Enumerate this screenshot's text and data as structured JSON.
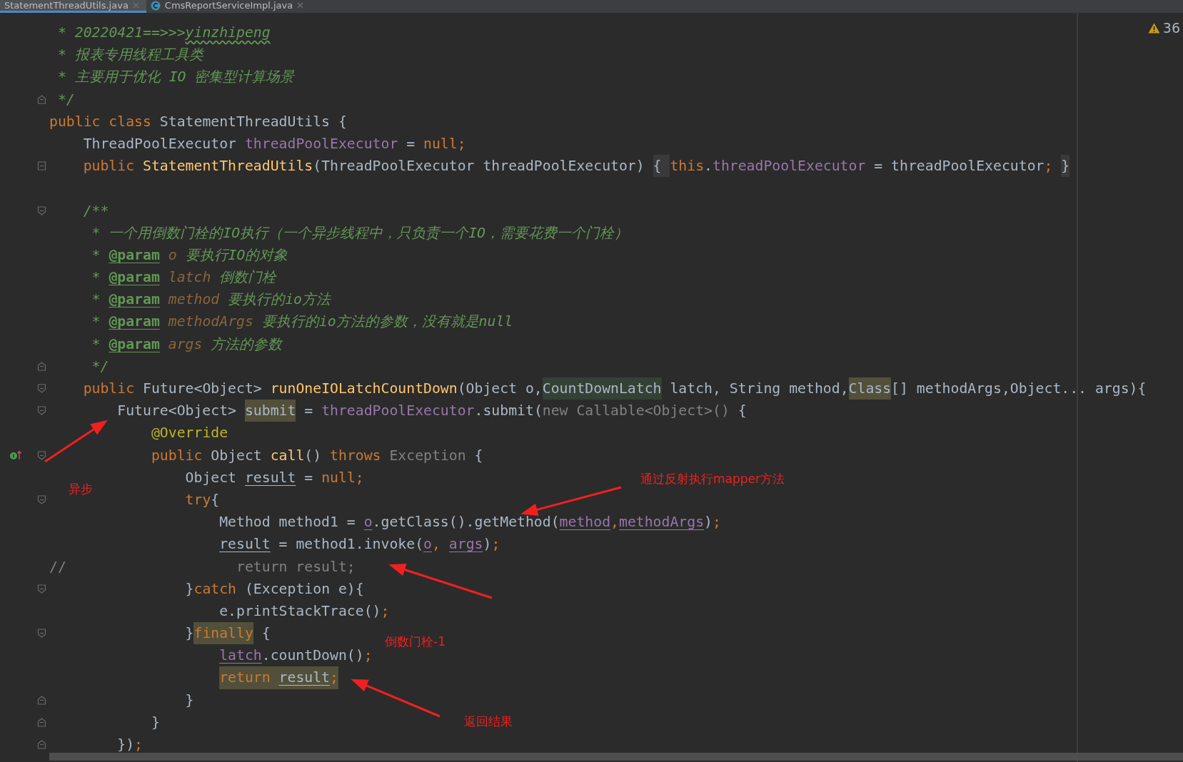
{
  "tabs": [
    {
      "label": "StatementThreadUtils.java",
      "selected": true,
      "icon": false
    },
    {
      "label": "CmsReportServiceImpl.java",
      "selected": false,
      "icon": true
    }
  ],
  "inspections": {
    "warnings": "36"
  },
  "lines": [
    {
      "kind": "plain",
      "tokens": [
        {
          "text": " * 20220421==>>>",
          "kind": "comment"
        },
        {
          "text": "yinzhipeng",
          "kind": "comment",
          "misspelled": true
        }
      ]
    },
    {
      "kind": "plain",
      "tokens": [
        {
          "text": " * 报表专用线程工具类",
          "kind": "comment"
        }
      ]
    },
    {
      "kind": "plain",
      "tokens": [
        {
          "text": " * 主要用于优化 IO 密集型计算场景",
          "kind": "comment"
        }
      ]
    },
    {
      "kind": "fold_end",
      "tokens": [
        {
          "text": " */",
          "kind": "comment"
        }
      ]
    },
    {
      "kind": "plain",
      "tokens": [
        {
          "text": "public class",
          "kind": "keyword"
        },
        {
          "text": " StatementThreadUtils {",
          "kind": "plain"
        }
      ]
    },
    {
      "kind": "plain",
      "tokens": [
        {
          "text": "    ThreadPoolExecutor ",
          "kind": "plain"
        },
        {
          "text": "threadPoolExecutor",
          "kind": "field"
        },
        {
          "text": " = ",
          "kind": "plain"
        },
        {
          "text": "null;",
          "kind": "keyword"
        }
      ]
    },
    {
      "kind": "fold_block",
      "tokens": [
        {
          "text": "    public",
          "kind": "keyword"
        },
        {
          "text": " StatementThreadUtils",
          "kind": "declaration"
        },
        {
          "text": "(ThreadPoolExecutor threadPoolExecutor) ",
          "kind": "plain"
        },
        {
          "text": "{ ",
          "kind": "folded_brace"
        },
        {
          "text": "this",
          "kind": "keyword"
        },
        {
          "text": ".",
          "kind": "plain"
        },
        {
          "text": "threadPoolExecutor",
          "kind": "field"
        },
        {
          "text": " = threadPoolExecutor",
          "kind": "plain"
        },
        {
          "text": ";",
          "kind": "keyword"
        },
        {
          "text": " }",
          "kind": "folded_brace"
        }
      ]
    },
    {
      "kind": "plain"
    },
    {
      "kind": "fold_start",
      "tokens": [
        {
          "text": "    /**",
          "kind": "comment"
        }
      ]
    },
    {
      "kind": "plain",
      "tokens": [
        {
          "text": "     * 一个用倒数门栓的IO执行（一个异步线程中，只负责一个IO，需要花费一个门栓）",
          "kind": "comment"
        }
      ]
    },
    {
      "kind": "plain",
      "tokens": [
        {
          "text": "     * ",
          "kind": "comment"
        },
        {
          "text": "@param",
          "kind": "doc_tag"
        },
        {
          "text": " o",
          "kind": "doc_param"
        },
        {
          "text": " 要执行IO的对象",
          "kind": "comment"
        }
      ]
    },
    {
      "kind": "plain",
      "tokens": [
        {
          "text": "     * ",
          "kind": "comment"
        },
        {
          "text": "@param",
          "kind": "doc_tag"
        },
        {
          "text": " latch",
          "kind": "doc_param"
        },
        {
          "text": " 倒数门栓",
          "kind": "comment"
        }
      ]
    },
    {
      "kind": "plain",
      "tokens": [
        {
          "text": "     * ",
          "kind": "comment"
        },
        {
          "text": "@param",
          "kind": "doc_tag"
        },
        {
          "text": " method",
          "kind": "doc_param"
        },
        {
          "text": " 要执行的io方法",
          "kind": "comment"
        }
      ]
    },
    {
      "kind": "plain",
      "tokens": [
        {
          "text": "     * ",
          "kind": "comment"
        },
        {
          "text": "@param",
          "kind": "doc_tag"
        },
        {
          "text": " methodArgs",
          "kind": "doc_param"
        },
        {
          "text": " 要执行的io方法的参数，没有就是null",
          "kind": "comment"
        }
      ]
    },
    {
      "kind": "plain",
      "tokens": [
        {
          "text": "     * ",
          "kind": "comment"
        },
        {
          "text": "@param",
          "kind": "doc_tag"
        },
        {
          "text": " args",
          "kind": "doc_param"
        },
        {
          "text": " 方法的参数",
          "kind": "comment"
        }
      ]
    },
    {
      "kind": "fold_end",
      "tokens": [
        {
          "text": "     */",
          "kind": "comment"
        }
      ]
    },
    {
      "kind": "fold_start",
      "tokens": [
        {
          "text": "    public",
          "kind": "keyword"
        },
        {
          "text": " Future<Object> ",
          "kind": "plain"
        },
        {
          "text": "runOneIOLatchCountDown",
          "kind": "declaration"
        },
        {
          "text": "(Object o,",
          "kind": "plain"
        },
        {
          "text": "CountDownLatch",
          "kind": "type_usage"
        },
        {
          "text": " latch,",
          "kind": "plain"
        },
        {
          "text": " String method,",
          "kind": "plain"
        },
        {
          "text": "Class",
          "kind": "plain",
          "highlighted": true
        },
        {
          "text": "[] methodArgs,",
          "kind": "plain"
        },
        {
          "text": "Object... args){",
          "kind": "plain"
        }
      ]
    },
    {
      "kind": "fold_start",
      "tokens": [
        {
          "text": "        Future<Object> ",
          "kind": "plain"
        },
        {
          "text": "submit",
          "kind": "plain",
          "highlighted": true
        },
        {
          "text": " = ",
          "kind": "plain"
        },
        {
          "text": "threadPoolExecutor",
          "kind": "field"
        },
        {
          "text": ".submit(",
          "kind": "plain"
        },
        {
          "text": "new Callable<Object>()",
          "kind": "dim"
        },
        {
          "text": " {",
          "kind": "plain"
        }
      ]
    },
    {
      "kind": "plain",
      "tokens": [
        {
          "text": "            @Override",
          "kind": "annotation"
        }
      ]
    },
    {
      "kind": "fold_start",
      "override": true,
      "tokens": [
        {
          "text": "            public",
          "kind": "keyword"
        },
        {
          "text": " Object ",
          "kind": "plain"
        },
        {
          "text": "call",
          "kind": "declaration"
        },
        {
          "text": "() ",
          "kind": "plain"
        },
        {
          "text": "throws",
          "kind": "keyword"
        },
        {
          "text": " Exception",
          "kind": "dim"
        },
        {
          "text": " {",
          "kind": "plain"
        }
      ]
    },
    {
      "kind": "plain",
      "tokens": [
        {
          "text": "                Object ",
          "kind": "plain"
        },
        {
          "text": "result",
          "kind": "plain",
          "underlined": true
        },
        {
          "text": " = ",
          "kind": "plain"
        },
        {
          "text": "null;",
          "kind": "keyword"
        }
      ]
    },
    {
      "kind": "fold_start",
      "tokens": [
        {
          "text": "                try",
          "kind": "keyword"
        },
        {
          "text": "{",
          "kind": "plain"
        }
      ]
    },
    {
      "kind": "plain",
      "tokens": [
        {
          "text": "                    Method method1 = ",
          "kind": "plain"
        },
        {
          "text": "o",
          "kind": "field",
          "underlined": true
        },
        {
          "text": ".getClass().getMethod(",
          "kind": "plain"
        },
        {
          "text": "method",
          "kind": "field",
          "underlined": true
        },
        {
          "text": ",",
          "kind": "keyword"
        },
        {
          "text": "methodArgs",
          "kind": "field",
          "underlined": true
        },
        {
          "text": ")",
          "kind": "plain"
        },
        {
          "text": ";",
          "kind": "keyword"
        }
      ]
    },
    {
      "kind": "plain",
      "tokens": [
        {
          "text": "                    result",
          "kind": "plain",
          "underlined": true
        },
        {
          "text": " = method1.invoke(",
          "kind": "plain"
        },
        {
          "text": "o",
          "kind": "field",
          "underlined": true
        },
        {
          "text": ",",
          "kind": "keyword"
        },
        {
          "text": " args",
          "kind": "field",
          "underlined": true
        },
        {
          "text": ")",
          "kind": "plain"
        },
        {
          "text": ";",
          "kind": "keyword"
        }
      ]
    },
    {
      "kind": "plain",
      "tokens": [
        {
          "text": "//                    return result;",
          "kind": "line_comment"
        }
      ]
    },
    {
      "kind": "fold_start",
      "tokens": [
        {
          "text": "                }",
          "kind": "plain"
        },
        {
          "text": "catch",
          "kind": "keyword"
        },
        {
          "text": " (Exception e){",
          "kind": "plain"
        }
      ]
    },
    {
      "kind": "plain",
      "tokens": [
        {
          "text": "                    e.printStackTrace()",
          "kind": "plain"
        },
        {
          "text": ";",
          "kind": "keyword"
        }
      ]
    },
    {
      "kind": "fold_start",
      "tokens": [
        {
          "text": "                }",
          "kind": "plain"
        },
        {
          "text": "finally",
          "kind": "keyword",
          "highlighted": true
        },
        {
          "text": " {",
          "kind": "plain"
        }
      ]
    },
    {
      "kind": "plain",
      "tokens": [
        {
          "text": "                    latch",
          "kind": "field",
          "underlined": true
        },
        {
          "text": ".countDown()",
          "kind": "plain"
        },
        {
          "text": ";",
          "kind": "keyword"
        }
      ]
    },
    {
      "kind": "plain",
      "tokens": [
        {
          "text": "                    return ",
          "kind": "keyword",
          "highlighted": true
        },
        {
          "text": "result",
          "kind": "plain",
          "underlined": true,
          "highlighted": true
        },
        {
          "text": ";",
          "kind": "keyword",
          "highlighted": true
        }
      ]
    },
    {
      "kind": "fold_end",
      "tokens": [
        {
          "text": "                }",
          "kind": "plain"
        }
      ]
    },
    {
      "kind": "fold_end",
      "tokens": [
        {
          "text": "            }",
          "kind": "plain"
        }
      ]
    },
    {
      "kind": "fold_end",
      "tokens": [
        {
          "text": "        })",
          "kind": "plain"
        },
        {
          "text": ";",
          "kind": "keyword"
        }
      ]
    }
  ],
  "annotations": [
    {
      "text": "异步"
    },
    {
      "text": "通过反射执行mapper方法"
    },
    {
      "text": "倒数门栓-1"
    },
    {
      "text": "返回结果"
    }
  ]
}
